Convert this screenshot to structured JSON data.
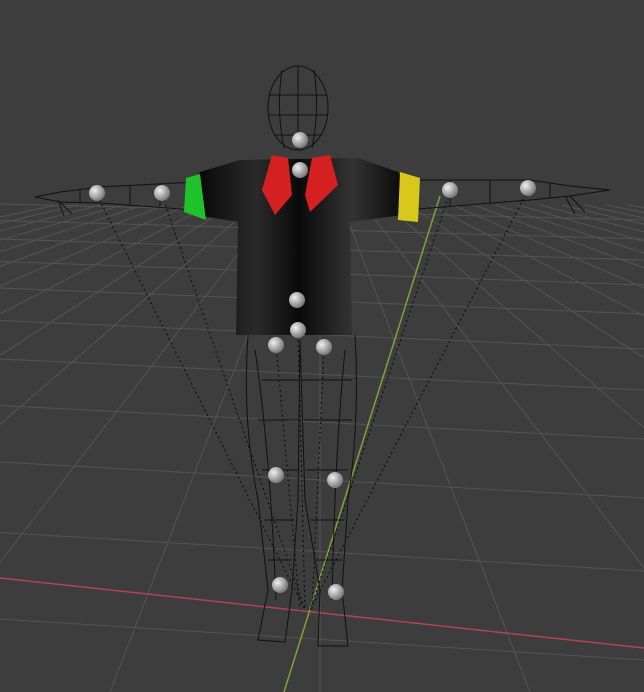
{
  "viewport": {
    "background_color": "#3d3d3d",
    "grid_color": "#545454",
    "x_axis_color": "#b04552",
    "y_axis_color": "#7da33a"
  },
  "model": {
    "shirt_color": "#0b0b0b",
    "collar_color": "#d42020",
    "left_cuff_color": "#1fc22a",
    "right_cuff_color": "#d8c81c",
    "wireframe_color": "#111111",
    "joint_color": "#bdbdbd"
  }
}
